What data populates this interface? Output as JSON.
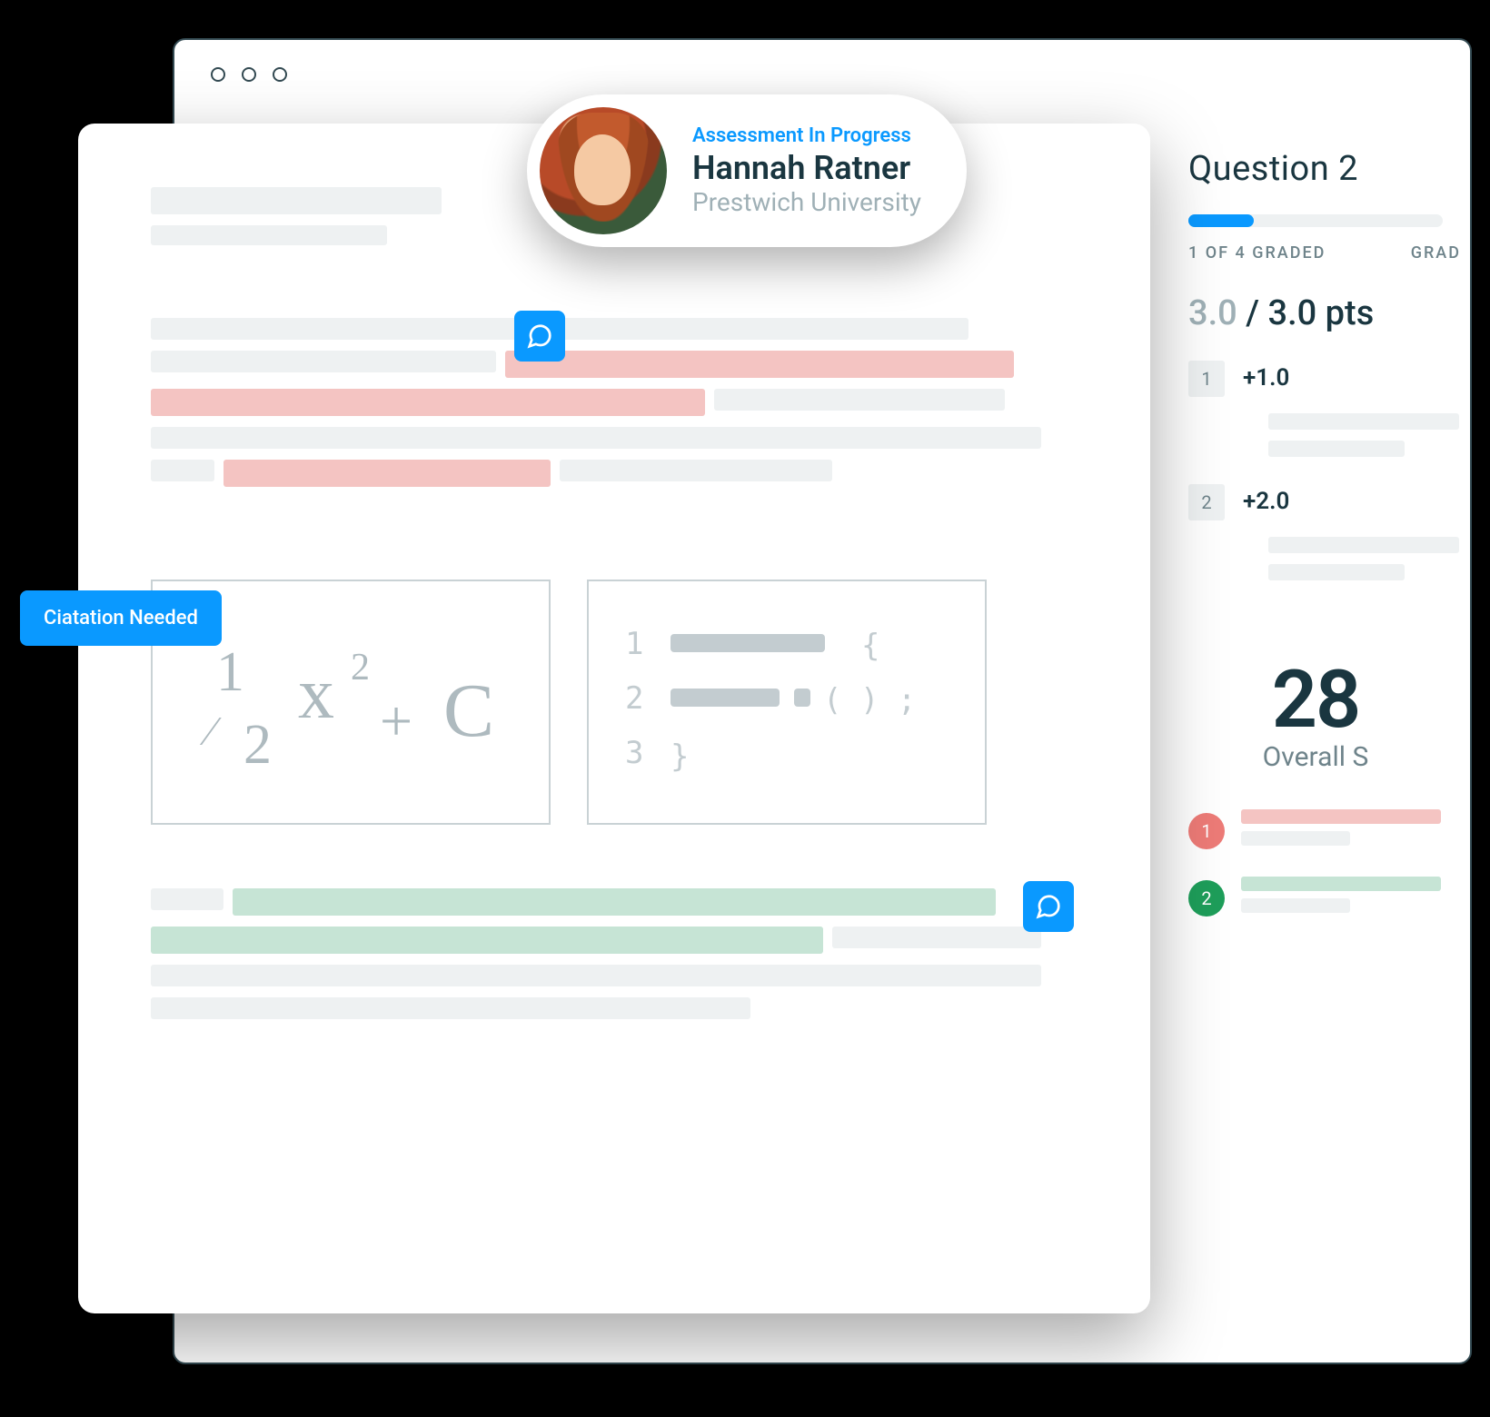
{
  "student": {
    "status": "Assessment In Progress",
    "name": "Hannah Ratner",
    "university": "Prestwich University"
  },
  "annotation": {
    "citation_label": "Ciatation Needed"
  },
  "images": {
    "math_expr": "½ x² + C",
    "code_lines": [
      "1",
      "2",
      "3"
    ]
  },
  "grading": {
    "question_title": "Question 2",
    "progress_label_left": "1 OF 4 GRADED",
    "progress_label_right": "GRAD",
    "score_earned": "3.0",
    "score_separator": " / ",
    "score_total": "3.0 pts",
    "rubric": [
      {
        "num": "1",
        "delta": "+1.0"
      },
      {
        "num": "2",
        "delta": "+2.0"
      }
    ],
    "overall_value": "28",
    "overall_label": "Overall S",
    "legend": [
      {
        "num": "1",
        "color": "red"
      },
      {
        "num": "2",
        "color": "green"
      }
    ]
  }
}
